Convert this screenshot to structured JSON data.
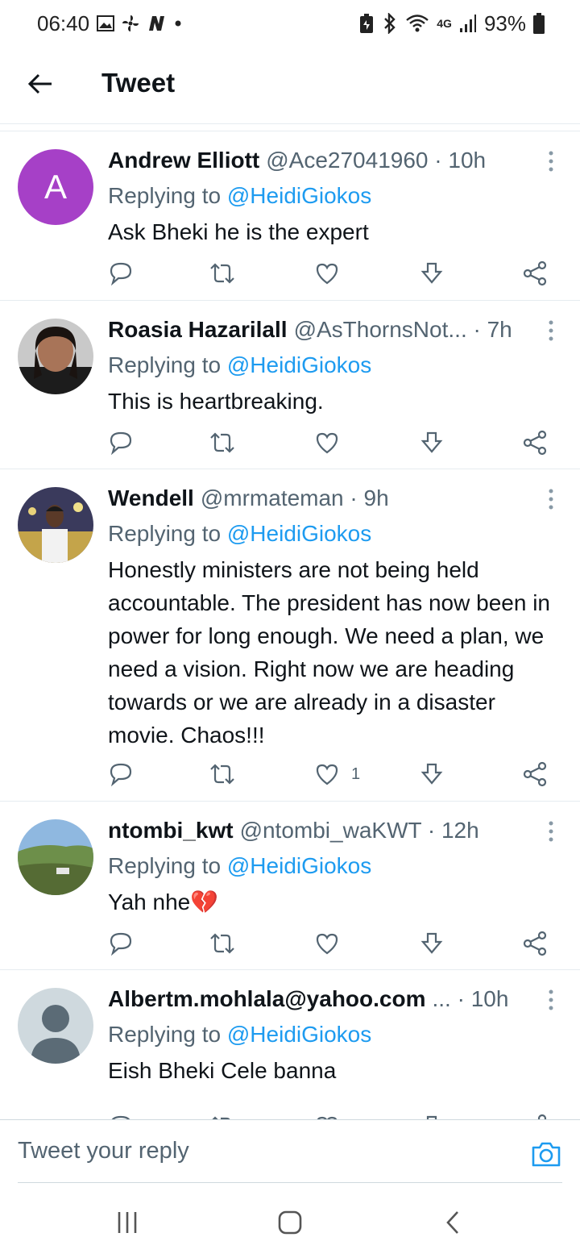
{
  "status_bar": {
    "time": "06:40",
    "battery": "93%",
    "network": "4G"
  },
  "header": {
    "title": "Tweet"
  },
  "tweets": [
    {
      "name": "Andrew Elliott",
      "handle_time": "@Ace27041960 · 10h",
      "replying_prefix": "Replying to ",
      "replying_to": "@HeidiGiokos",
      "text": "Ask Bheki he is the expert",
      "avatar_letter": "A",
      "like_count": ""
    },
    {
      "name": "Roasia Hazarilall",
      "handle_time": "@AsThornsNot... · 7h",
      "replying_prefix": "Replying to ",
      "replying_to": "@HeidiGiokos",
      "text": "This is heartbreaking.",
      "avatar_letter": "",
      "like_count": ""
    },
    {
      "name": "Wendell",
      "handle_time": "@mrmateman · 9h",
      "replying_prefix": "Replying to ",
      "replying_to": "@HeidiGiokos",
      "text": "Honestly ministers are not being held accountable. The president has now been in power for long enough. We need a plan, we need a vision. Right now we are heading towards or we are already in a disaster movie. Chaos!!!",
      "avatar_letter": "",
      "like_count": "1"
    },
    {
      "name": "ntombi_kwt",
      "handle_time": "@ntombi_waKWT · 12h",
      "replying_prefix": "Replying to ",
      "replying_to": "@HeidiGiokos",
      "text": "Yah nhe💔",
      "avatar_letter": "",
      "like_count": ""
    },
    {
      "name": "Albertm.mohlala@yahoo.com",
      "handle_time": "... · 10h",
      "replying_prefix": "Replying to ",
      "replying_to": "@HeidiGiokos",
      "text": "Eish Bheki Cele banna",
      "avatar_letter": "",
      "like_count": ""
    }
  ],
  "reply_bar": {
    "placeholder": "Tweet your reply"
  },
  "colors": {
    "accent": "#1d9bf0",
    "avatar_a": "#a640c7",
    "muted": "#536471"
  }
}
